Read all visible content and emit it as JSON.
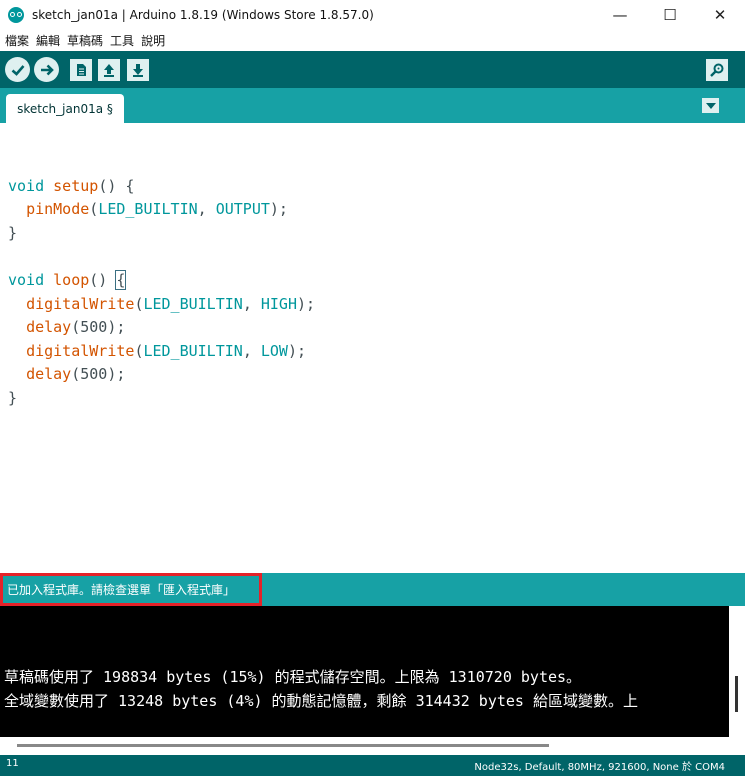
{
  "window": {
    "title": "sketch_jan01a | Arduino 1.8.19 (Windows Store 1.8.57.0)",
    "minimize_glyph": "—",
    "maximize_glyph": "☐",
    "close_glyph": "✕"
  },
  "menu": {
    "items": [
      {
        "label": "檔案"
      },
      {
        "label": "編輯"
      },
      {
        "label": "草稿碼"
      },
      {
        "label": "工具"
      },
      {
        "label": "說明"
      }
    ]
  },
  "toolbar": {
    "buttons": [
      {
        "name": "verify",
        "icon": "check-icon"
      },
      {
        "name": "upload",
        "icon": "arrow-right-icon"
      },
      {
        "name": "new",
        "icon": "document-icon"
      },
      {
        "name": "open",
        "icon": "arrow-up-icon"
      },
      {
        "name": "save",
        "icon": "arrow-down-icon"
      },
      {
        "name": "serial-monitor",
        "icon": "magnifier-icon"
      }
    ]
  },
  "tabs": [
    {
      "label": "sketch_jan01a §",
      "active": true
    }
  ],
  "editor": {
    "lines": [
      "",
      "void setup() {",
      "  pinMode(LED_BUILTIN, OUTPUT);",
      "}",
      "",
      "void loop() {",
      "  digitalWrite(LED_BUILTIN, HIGH);",
      "  delay(500);",
      "  digitalWrite(LED_BUILTIN, LOW);",
      "  delay(500);",
      "}"
    ]
  },
  "status": {
    "message": "已加入程式庫。請檢查選單「匯入程式庫」"
  },
  "console": {
    "lines": [
      "草稿碼使用了 198834 bytes (15%) 的程式儲存空間。上限為 1310720 bytes。",
      "全域變數使用了 13248 bytes (4%) 的動態記憶體，剩餘 314432 bytes 給區域變數。上"
    ]
  },
  "footer": {
    "line_number": "11",
    "board_info": "Node32s, Default, 80MHz, 921600, None 於 COM4"
  },
  "colors": {
    "toolbar_bg": "#006468",
    "tab_bar_bg": "#17a1a5",
    "keyword": "#00979c",
    "function": "#d35400",
    "status_highlight_border": "#e52229"
  }
}
